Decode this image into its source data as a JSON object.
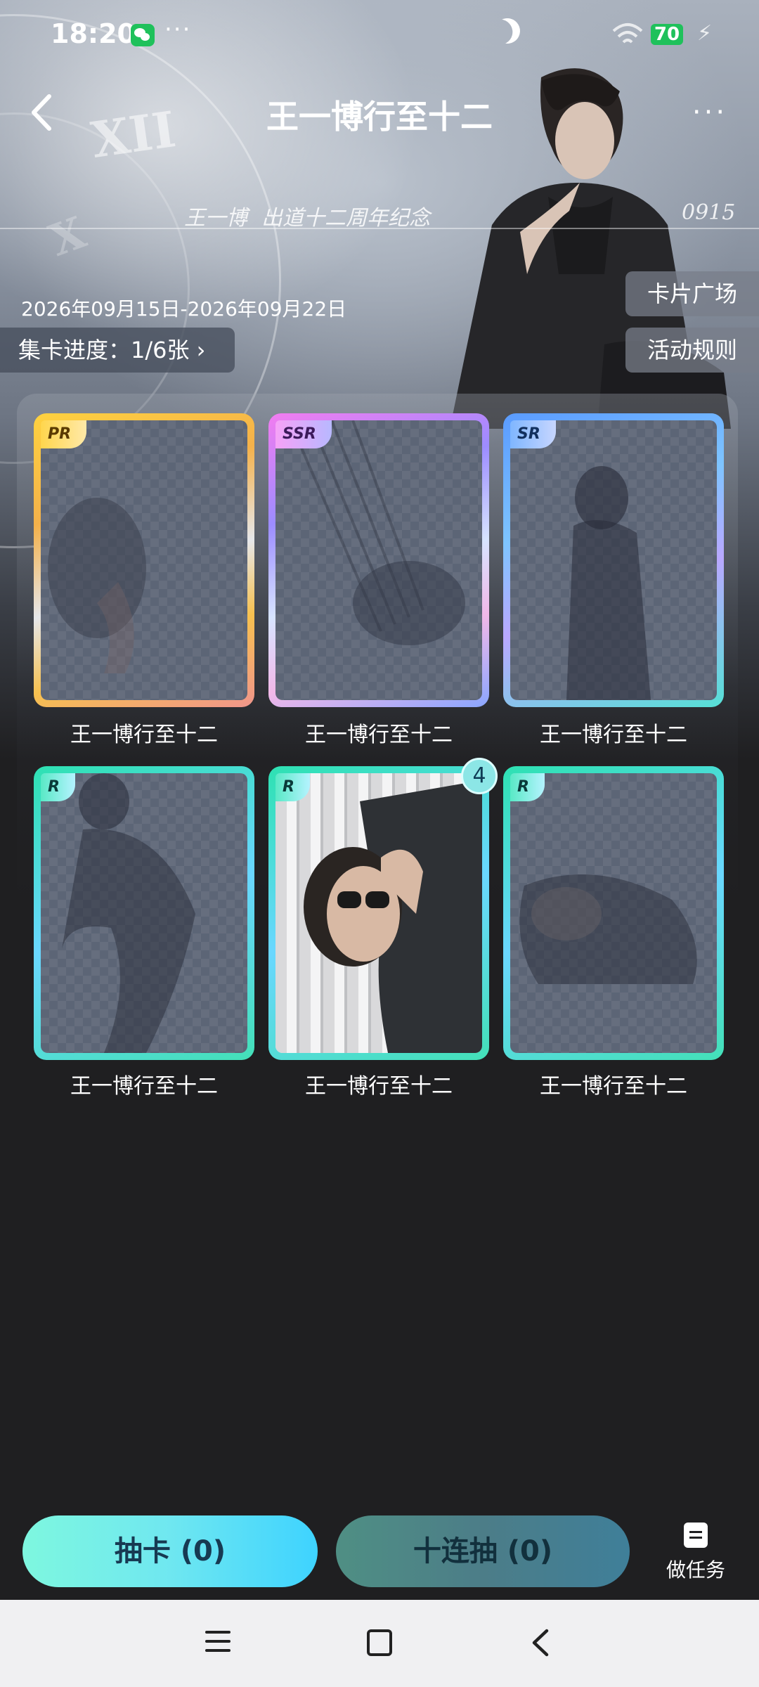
{
  "status_bar": {
    "time": "18:20",
    "dots": "···",
    "battery": "70",
    "icons": [
      "wechat-icon",
      "moon-icon",
      "wifi-icon",
      "battery-icon",
      "charging-bolt-icon"
    ]
  },
  "header": {
    "title": "王一博行至十二",
    "back_icon": "chevron-left-icon",
    "more_label": "···"
  },
  "hero": {
    "caption_left": "王一博",
    "caption_mid": "出道十二周年纪念",
    "caption_right": "0915",
    "roman_numerals": [
      "XII",
      "X"
    ]
  },
  "event": {
    "date_range": "2026年09月15日-2026年09月22日",
    "progress_label": "集卡进度：1/6张 ›",
    "card_plaza": "卡片广场",
    "rules": "活动规则"
  },
  "cards": [
    {
      "rarity": "PR",
      "name": "王一博行至十二",
      "owned": false
    },
    {
      "rarity": "SSR",
      "name": "王一博行至十二",
      "owned": false
    },
    {
      "rarity": "SR",
      "name": "王一博行至十二",
      "owned": false
    },
    {
      "rarity": "R",
      "name": "王一博行至十二",
      "owned": false
    },
    {
      "rarity": "R",
      "name": "王一博行至十二",
      "owned": true,
      "count": "4"
    },
    {
      "rarity": "R",
      "name": "王一博行至十二",
      "owned": false
    }
  ],
  "actions": {
    "draw": "抽卡 (0)",
    "ten_draw": "十连抽 (0)",
    "tasks": "做任务"
  },
  "colors": {
    "background": "#1f1f21",
    "draw_button": "#6fe7f0",
    "ten_button": "#4c7d88",
    "pr_frame": "#ffd23f",
    "ssr_frame": "#9c8cff",
    "sr_frame": "#5a9bff",
    "r_frame": "#2ee1b2"
  }
}
